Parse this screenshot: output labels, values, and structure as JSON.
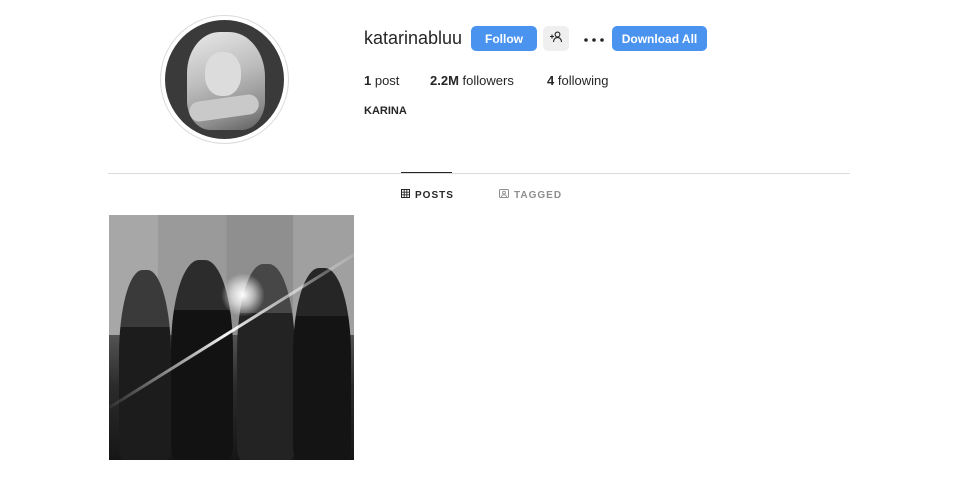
{
  "profile": {
    "username": "katarinabluu",
    "full_name": "KARINA",
    "avatar_icon": "profile-photo"
  },
  "actions": {
    "follow_label": "Follow",
    "suggest_icon": "person-plus-icon",
    "more_icon": "more-options-icon",
    "download_label": "Download All"
  },
  "stats": {
    "posts_count": "1",
    "posts_label": " post",
    "followers_count": "2.2M",
    "followers_label": " followers",
    "following_count": "4",
    "following_label": " following"
  },
  "tabs": [
    {
      "label": "POSTS",
      "icon": "grid-icon",
      "active": true
    },
    {
      "label": "TAGGED",
      "icon": "tagged-icon",
      "active": false
    }
  ],
  "colors": {
    "accent": "#4a93ef",
    "text": "#262626",
    "muted": "#8e8e8e",
    "divider": "#dbdbdb"
  }
}
